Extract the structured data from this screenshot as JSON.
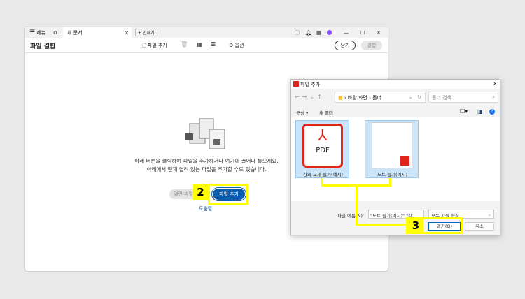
{
  "app": {
    "menu_label": "메뉴",
    "tab_title": "새 문서",
    "new_tab_label": "+ 인쇄기"
  },
  "toolbar": {
    "title": "파일 결합",
    "add_file": "파일 추가",
    "options": "옵션",
    "close": "닫기",
    "combine": "결합"
  },
  "main": {
    "line1": "아래 버튼을 클릭하여 파일을 추가하거나 여기에 끌어다 놓으세요.",
    "line2": "아래에서 현재 열려 있는 파일을 추가할 수도 있습니다.",
    "open_files_button": "열린 파일",
    "add_file_button": "파일 추가",
    "help_link": "도움말",
    "step_label": "2"
  },
  "dialog": {
    "title": "파일 추가",
    "path": [
      "바탕 화면",
      "폴더"
    ],
    "search_placeholder": "폴더 검색",
    "organize": "구성",
    "new_folder": "새 폴더",
    "files": [
      {
        "name": "강의 교재 필기(예시)",
        "thumb": "PDF"
      },
      {
        "name": "노트 필기(예시)"
      }
    ],
    "filename_label": "파일 이름(N):",
    "filename_value": "\"노트 필기(예시)\" \"강",
    "filetype": "모든 지원 형식",
    "open_button": "열기(O)",
    "cancel_button": "취소",
    "step_label": "3"
  },
  "colors": {
    "accent": "#0b5cad",
    "highlight": "#ffff00",
    "pdf_red": "#e0251b"
  }
}
